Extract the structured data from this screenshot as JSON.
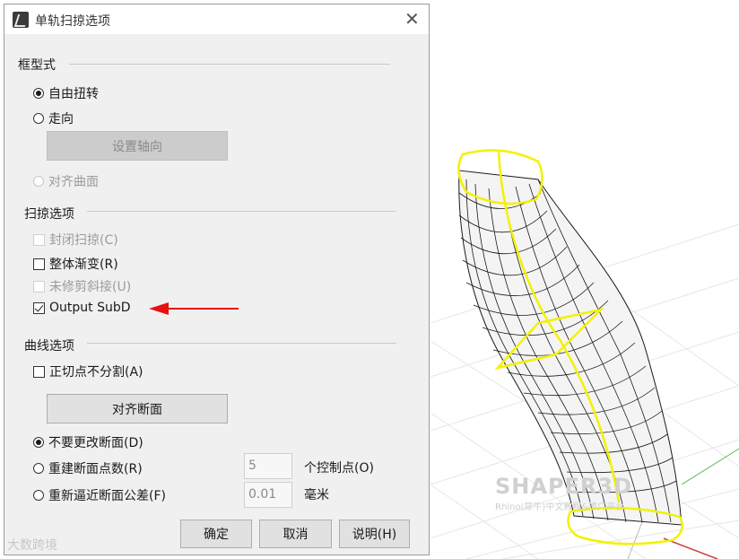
{
  "dialog": {
    "title": "单轨扫掠选项",
    "close_glyph": "✕"
  },
  "frame_style": {
    "heading": "框型式",
    "free_twist": "自由扭转",
    "roadlike": "走向",
    "set_axis_button": "设置轴向",
    "align_surface": "对齐曲面"
  },
  "sweep_options": {
    "heading": "扫掠选项",
    "closed_sweep": "封闭扫掠(C)",
    "global_shape_blending": "整体渐变(R)",
    "untrimmed_miters": "未修剪斜接(U)",
    "output_subd": "Output SubD",
    "output_subd_checked": true
  },
  "curve_options": {
    "heading": "曲线选项",
    "no_split_tangent": "正切点不分割(A)",
    "align_cross_sections_button": "对齐断面",
    "do_not_change": "不要更改断面(D)",
    "rebuild_points": "重建断面点数(R)",
    "rebuild_points_value": "5",
    "rebuild_points_unit": "个控制点(O)",
    "refit_tolerance": "重新逼近断面公差(F)",
    "refit_tolerance_value": "0.01",
    "refit_tolerance_unit": "毫米"
  },
  "footer": {
    "ok": "确定",
    "cancel": "取消",
    "help": "说明(H)"
  },
  "watermark": {
    "left_text": "大数跨境",
    "brand": "SHAPER3D",
    "brand_sub": "Rhino(犀牛)中文教程&推广平台"
  },
  "colors": {
    "highlight_yellow": "#f2f200",
    "arrow_red": "#e81010"
  }
}
